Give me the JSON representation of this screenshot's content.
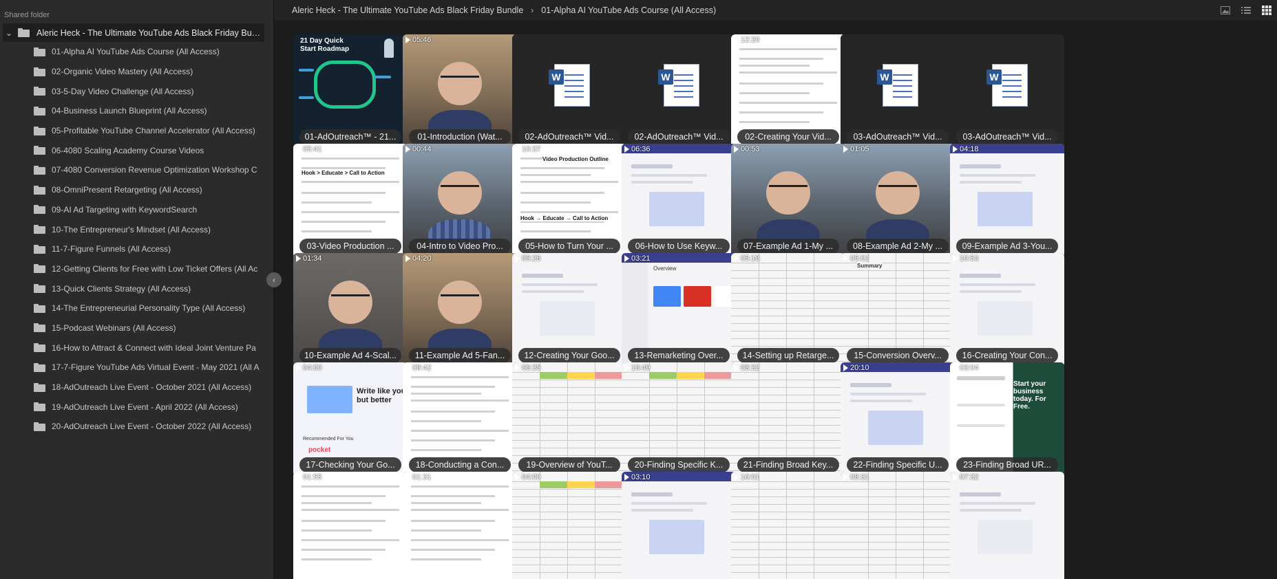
{
  "sidebar": {
    "title": "Shared folder",
    "root": {
      "label": "Aleric Heck - The Ultimate YouTube Ads Black Friday Bundle",
      "expanded": true
    },
    "items": [
      {
        "label": "01-Alpha AI YouTube Ads Course (All Access)"
      },
      {
        "label": "02-Organic Video Mastery (All Access)"
      },
      {
        "label": "03-5-Day Video Challenge (All Access)"
      },
      {
        "label": "04-Business Launch Blueprint (All Access)"
      },
      {
        "label": "05-Profitable YouTube Channel Accelerator (All Access)"
      },
      {
        "label": "06-4080 Scaling Academy Course Videos"
      },
      {
        "label": "07-4080 Conversion Revenue Optimization Workshop C"
      },
      {
        "label": "08-OmniPresent Retargeting (All Access)"
      },
      {
        "label": "09-AI Ad Targeting with KeywordSearch"
      },
      {
        "label": "10-The Entrepreneur's Mindset (All Access)"
      },
      {
        "label": "11-7-Figure Funnels (All Access)"
      },
      {
        "label": "12-Getting Clients for Free with Low Ticket Offers (All Ac"
      },
      {
        "label": "13-Quick Clients Strategy (All Access)"
      },
      {
        "label": "14-The Entrepreneurial Personality Type (All Access)"
      },
      {
        "label": "15-Podcast Webinars (All Access)"
      },
      {
        "label": "16-How to Attract & Connect with Ideal Joint Venture Pa"
      },
      {
        "label": "17-7-Figure YouTube Ads Virtual Event - May 2021 (All A"
      },
      {
        "label": "18-AdOutreach Live Event - October 2021 (All Access)"
      },
      {
        "label": "19-AdOutreach Live Event - April 2022 (All Access)"
      },
      {
        "label": "20-AdOutreach Live Event - October 2022 (All Access)"
      }
    ],
    "collapse_icon": "chevron-left-icon"
  },
  "breadcrumb": {
    "items": [
      "Aleric Heck - The Ultimate YouTube Ads Black Friday Bundle",
      "01-Alpha AI YouTube Ads Course (All Access)"
    ],
    "separator": "›"
  },
  "view_buttons": [
    {
      "icon": "image-view-icon",
      "active": false
    },
    {
      "icon": "list-view-icon",
      "active": false
    },
    {
      "icon": "grid-view-icon",
      "active": true
    }
  ],
  "colors": {
    "sidebar_bg": "#2b2b2b",
    "content_bg": "#1c1c1c",
    "header_bg": "#232323",
    "word_blue": "#2b5797"
  },
  "tiles": [
    {
      "name": "01-AdOutreach™ - 21...",
      "duration": "",
      "kind": "roadmap",
      "text": "21 Day Quick Start Roadmap"
    },
    {
      "name": "01-Introduction (Wat...",
      "duration": "05:46",
      "kind": "person-warm"
    },
    {
      "name": "02-AdOutreach™ Vid...",
      "duration": "",
      "kind": "word",
      "icon_letter": "W"
    },
    {
      "name": "02-AdOutreach™ Vid...",
      "duration": "",
      "kind": "word",
      "icon_letter": "W"
    },
    {
      "name": "02-Creating Your Vid...",
      "duration": "12:20",
      "kind": "doc"
    },
    {
      "name": "03-AdOutreach™ Vid...",
      "duration": "",
      "kind": "word",
      "icon_letter": "W"
    },
    {
      "name": "03-AdOutreach™ Vid...",
      "duration": "",
      "kind": "word",
      "icon_letter": "W"
    },
    {
      "name": "03-Video Production ...",
      "duration": "05:41",
      "kind": "doc-hook",
      "text": "Hook > Educate > Call to Action"
    },
    {
      "name": "04-Intro to Video Pro...",
      "duration": "00:44",
      "kind": "person-plaid"
    },
    {
      "name": "05-How to Turn Your ...",
      "duration": "10:37",
      "kind": "doc-outline",
      "text": "Video Production Outline",
      "text2": "Hook → Educate → Call to Action"
    },
    {
      "name": "06-How to Use Keyw...",
      "duration": "06:36",
      "kind": "web"
    },
    {
      "name": "07-Example Ad 1-My ...",
      "duration": "00:53",
      "kind": "person-office"
    },
    {
      "name": "08-Example Ad 2-My ...",
      "duration": "01:05",
      "kind": "person-office"
    },
    {
      "name": "09-Example Ad 3-You...",
      "duration": "04:18",
      "kind": "web"
    },
    {
      "name": "10-Example Ad 4-Scal...",
      "duration": "01:34",
      "kind": "person-dark"
    },
    {
      "name": "11-Example Ad 5-Fan...",
      "duration": "04:20",
      "kind": "person-warm"
    },
    {
      "name": "12-Creating Your Goo...",
      "duration": "05:28",
      "kind": "web-light"
    },
    {
      "name": "13-Remarketing Over...",
      "duration": "03:21",
      "kind": "dashboard",
      "text": "Overview"
    },
    {
      "name": "14-Setting up Retarge...",
      "duration": "05:18",
      "kind": "sheet"
    },
    {
      "name": "15-Conversion Overv...",
      "duration": "05:02",
      "kind": "sheet-summary",
      "text": "Summary"
    },
    {
      "name": "16-Creating Your Con...",
      "duration": "10:53",
      "kind": "web-light"
    },
    {
      "name": "17-Checking Your Go...",
      "duration": "04:00",
      "kind": "write",
      "text": "Write like you but better",
      "text2": "Recommended For You",
      "text3": "pocket"
    },
    {
      "name": "18-Conducting a Con...",
      "duration": "08:42",
      "kind": "doc"
    },
    {
      "name": "19-Overview of YouT...",
      "duration": "06:35",
      "kind": "sheet-color"
    },
    {
      "name": "20-Finding Specific K...",
      "duration": "16:49",
      "kind": "sheet-color"
    },
    {
      "name": "21-Finding Broad Key...",
      "duration": "08:32",
      "kind": "sheet"
    },
    {
      "name": "22-Finding Specific U...",
      "duration": "20:10",
      "kind": "web"
    },
    {
      "name": "23-Finding Broad UR...",
      "duration": "03:04",
      "kind": "green",
      "text": "Start your business today. For Free."
    },
    {
      "name": "",
      "duration": "01:55",
      "kind": "doc"
    },
    {
      "name": "",
      "duration": "01:31",
      "kind": "doc"
    },
    {
      "name": "",
      "duration": "04:00",
      "kind": "sheet-color"
    },
    {
      "name": "",
      "duration": "03:10",
      "kind": "web"
    },
    {
      "name": "",
      "duration": "16:01",
      "kind": "sheet"
    },
    {
      "name": "",
      "duration": "08:31",
      "kind": "sheet"
    },
    {
      "name": "",
      "duration": "07:32",
      "kind": "web-light"
    }
  ]
}
